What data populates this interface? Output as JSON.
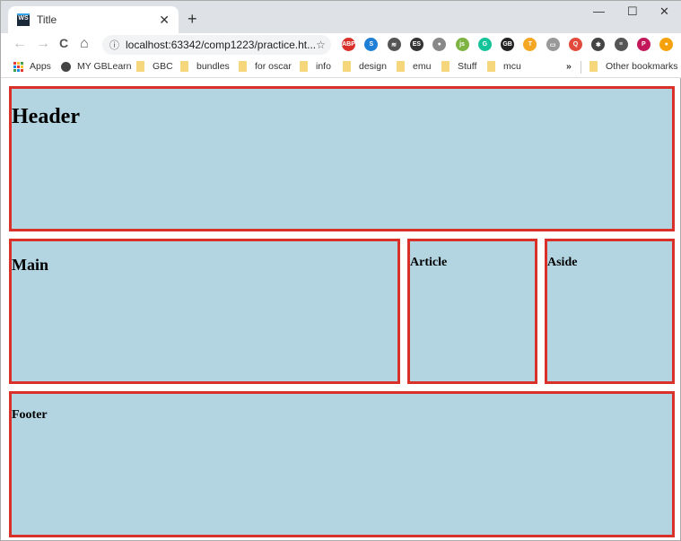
{
  "tab": {
    "title": "Title",
    "favicon": "WS",
    "close": "✕",
    "new_tab": "+"
  },
  "window": {
    "minimize": "—",
    "maximize": "☐",
    "close": "✕"
  },
  "toolbar": {
    "url": "localhost:63342/comp1223/practice.ht...",
    "back": "←",
    "forward": "→",
    "reload": "C",
    "home": "⌂",
    "info": "ⓘ",
    "star": "☆",
    "extensions": [
      {
        "label": "ABP",
        "color": "#d9312a"
      },
      {
        "label": "S",
        "color": "#1e7fd6"
      },
      {
        "label": "≋",
        "color": "#555555"
      },
      {
        "label": "ES",
        "color": "#333333"
      },
      {
        "label": "●",
        "color": "#888888"
      },
      {
        "label": "js",
        "color": "#7cb342"
      },
      {
        "label": "G",
        "color": "#15c39a"
      },
      {
        "label": "GB",
        "color": "#222222"
      },
      {
        "label": "T",
        "color": "#f5a623"
      },
      {
        "label": "▭",
        "color": "#999999"
      },
      {
        "label": "Q",
        "color": "#e24a3b"
      },
      {
        "label": "✱",
        "color": "#444444"
      },
      {
        "label": "≡",
        "color": "#555555"
      },
      {
        "label": "P",
        "color": "#c2185b"
      },
      {
        "label": "●",
        "color": "#f4a10b"
      }
    ]
  },
  "bookmarks": {
    "apps": "Apps",
    "items": [
      "MY GBLearn",
      "GBC",
      "bundles",
      "for oscar",
      "info",
      "design",
      "emu",
      "Stuff",
      "mcu"
    ],
    "more": "»",
    "other": "Other bookmarks"
  },
  "page": {
    "header": "Header",
    "main": "Main",
    "article": "Article",
    "aside": "Aside",
    "footer": "Footer",
    "box_color": "#b3d5e2",
    "border_color": "#d9312a"
  }
}
